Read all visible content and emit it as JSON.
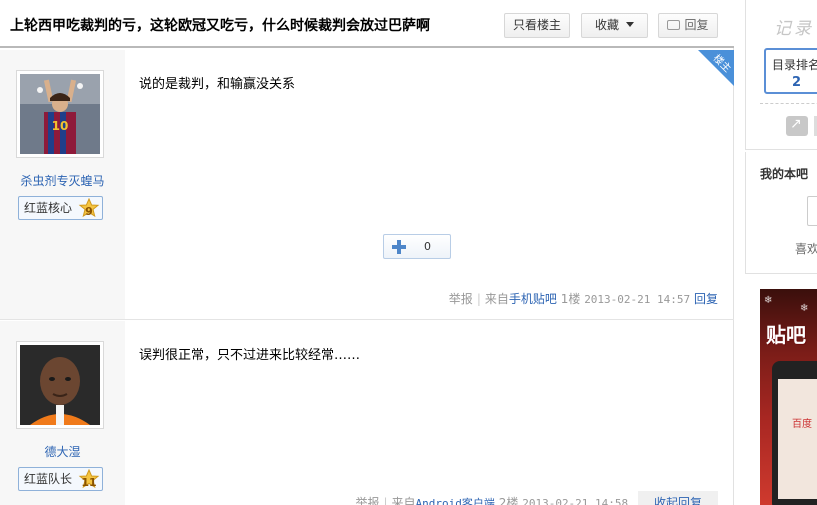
{
  "thread": {
    "title": "上轮西甲吃裁判的亏，这轮欧冠又吃亏，什么时候裁判会放过巴萨啊",
    "buttons": {
      "only_op": "只看楼主",
      "favorite": "收藏",
      "reply": "回复"
    }
  },
  "posts": [
    {
      "author": "杀虫剂专灭蝗马",
      "badge": "红蓝核心",
      "level": "9",
      "floor_tag": "楼主",
      "content": "说的是裁判，和输赢没关系",
      "like_count": "0",
      "report": "举报",
      "source_prefix": "来自",
      "source": "手机贴吧",
      "floor": "1楼",
      "time": "2013-02-21 14:57",
      "reply": "回复"
    },
    {
      "author": "德大湿",
      "badge": "红蓝队长",
      "level": "11",
      "content": "误判很正常，只不过进来比较经常……",
      "report": "举报",
      "source_prefix": "来自",
      "source": "Android客户端",
      "floor": "2楼",
      "time": "2013-02-21 14:58",
      "reply": "收起回复"
    }
  ],
  "sidebar": {
    "handwrite": "记录",
    "dir_label": "目录排名",
    "dir_num": "2",
    "my_bar": "我的本吧",
    "like_text": "喜欢",
    "ad_title": "贴吧",
    "ad_screen": "百度"
  },
  "colors": {
    "link": "#2d64b3",
    "accent": "#4a90d9"
  },
  "icons": [
    "reply-bubble-icon",
    "chevron-down-icon",
    "plus-icon",
    "level-star-icon",
    "share-icon"
  ]
}
